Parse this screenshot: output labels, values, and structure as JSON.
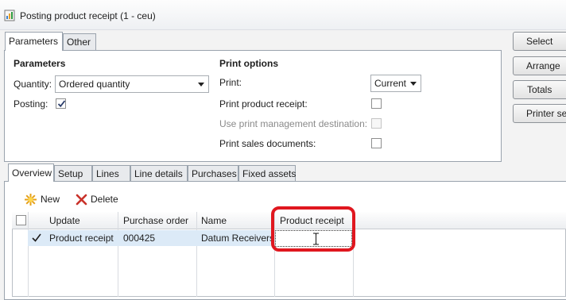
{
  "window": {
    "title": "Posting product receipt (1 - ceu)"
  },
  "top_tabs": [
    {
      "label": "Parameters",
      "active": true
    },
    {
      "label": "Other",
      "active": false
    }
  ],
  "parameters": {
    "heading": "Parameters",
    "quantity_label": "Quantity:",
    "quantity_value": "Ordered quantity",
    "posting_label": "Posting:",
    "posting_checked": true
  },
  "print_options": {
    "heading": "Print options",
    "print_label": "Print:",
    "print_value": "Current",
    "print_product_receipt_label": "Print product receipt:",
    "use_print_mgmt_label": "Use print management destination:",
    "print_sales_docs_label": "Print sales documents:"
  },
  "side_buttons": [
    "Select",
    "Arrange",
    "Totals",
    "Printer setup"
  ],
  "lower_tabs": [
    "Overview",
    "Setup",
    "Lines",
    "Line details",
    "Purchases",
    "Fixed assets"
  ],
  "toolbar": {
    "new_label": "New",
    "delete_label": "Delete"
  },
  "grid": {
    "columns": [
      "Update",
      "Purchase order",
      "Name",
      "Product receipt"
    ],
    "rows": [
      {
        "update": "Product receipt",
        "purchase_order": "000425",
        "name": "Datum Receivers",
        "product_receipt": ""
      }
    ]
  },
  "colors": {
    "highlight": "#e0171f",
    "selected_row": "#dceaf7"
  }
}
